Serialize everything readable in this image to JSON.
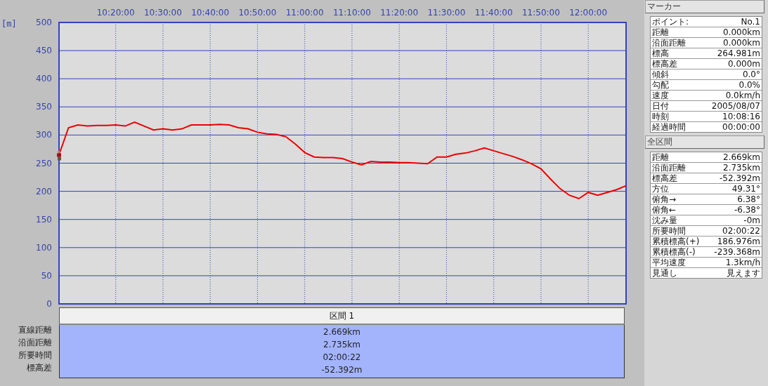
{
  "chart": {
    "chart_data": {
      "type": "line",
      "grid": true,
      "ylabel": "[m]",
      "ylim": [
        0,
        500
      ],
      "yticks": [
        0,
        50,
        100,
        150,
        200,
        250,
        300,
        350,
        400,
        450,
        500
      ],
      "categories": [
        null,
        null,
        null,
        null,
        null,
        null,
        "10:20:00",
        null,
        null,
        null,
        null,
        "10:30:00",
        null,
        null,
        null,
        null,
        "10:40:00",
        null,
        null,
        null,
        null,
        "10:50:00",
        null,
        null,
        null,
        null,
        "11:00:00",
        null,
        null,
        null,
        null,
        "11:10:00",
        null,
        null,
        null,
        null,
        "11:20:00",
        null,
        null,
        null,
        null,
        "11:30:00",
        null,
        null,
        null,
        null,
        "11:40:00",
        null,
        null,
        null,
        null,
        "11:50:00",
        null,
        null,
        null,
        null,
        "12:00:00",
        null,
        null,
        null,
        null
      ],
      "series": [
        {
          "color": "#ee0000",
          "values": [
            265,
            313,
            318,
            316,
            317,
            317,
            318,
            316,
            323,
            316,
            309,
            311,
            309,
            311,
            318,
            318,
            318,
            319,
            318,
            313,
            311,
            305,
            302,
            301,
            297,
            284,
            269,
            261,
            260,
            260,
            258,
            252,
            247,
            253,
            252,
            252,
            251,
            251,
            250,
            249,
            261,
            261,
            266,
            268,
            272,
            277,
            272,
            267,
            262,
            256,
            249,
            240,
            222,
            205,
            193,
            187,
            198,
            193,
            198,
            203,
            210
          ]
        }
      ]
    }
  },
  "section_table": {
    "header": "区間 1",
    "rows": [
      {
        "label": "直線距離",
        "value": "2.669km"
      },
      {
        "label": "沿面距離",
        "value": "2.735km"
      },
      {
        "label": "所要時間",
        "value": "02:00:22"
      },
      {
        "label": "標高差",
        "value": "-52.392m"
      }
    ]
  },
  "marker_panel": {
    "title": "マーカー",
    "rows": [
      {
        "label": "ポイント:",
        "value": "No.1"
      },
      {
        "label": "距離",
        "value": "0.000km"
      },
      {
        "label": "沿面距離",
        "value": "0.000km"
      },
      {
        "label": "標高",
        "value": "264.981m"
      },
      {
        "label": "標高差",
        "value": "0.000m"
      },
      {
        "label": "傾斜",
        "value": "0.0°"
      },
      {
        "label": "勾配",
        "value": "0.0%"
      },
      {
        "label": "速度",
        "value": "0.0km/h"
      },
      {
        "label": "日付",
        "value": "2005/08/07"
      },
      {
        "label": "時刻",
        "value": "10:08:16"
      },
      {
        "label": "経過時間",
        "value": "00:00:00"
      }
    ]
  },
  "total_panel": {
    "title": "全区間",
    "rows": [
      {
        "label": "距離",
        "value": "2.669km"
      },
      {
        "label": "沿面距離",
        "value": "2.735km"
      },
      {
        "label": "標高差",
        "value": "-52.392m"
      },
      {
        "label": "方位",
        "value": "49.31°"
      },
      {
        "label": "俯角→",
        "value": "6.38°"
      },
      {
        "label": "俯角←",
        "value": "-6.38°"
      },
      {
        "label": "沈み量",
        "value": "-0m"
      },
      {
        "label": "所要時間",
        "value": "02:00:22"
      },
      {
        "label": "累積標高(+)",
        "value": "186.976m"
      },
      {
        "label": "累積標高(-)",
        "value": "-239.368m"
      },
      {
        "label": "平均速度",
        "value": "1.3km/h"
      },
      {
        "label": "見通し",
        "value": "見えます"
      }
    ]
  }
}
